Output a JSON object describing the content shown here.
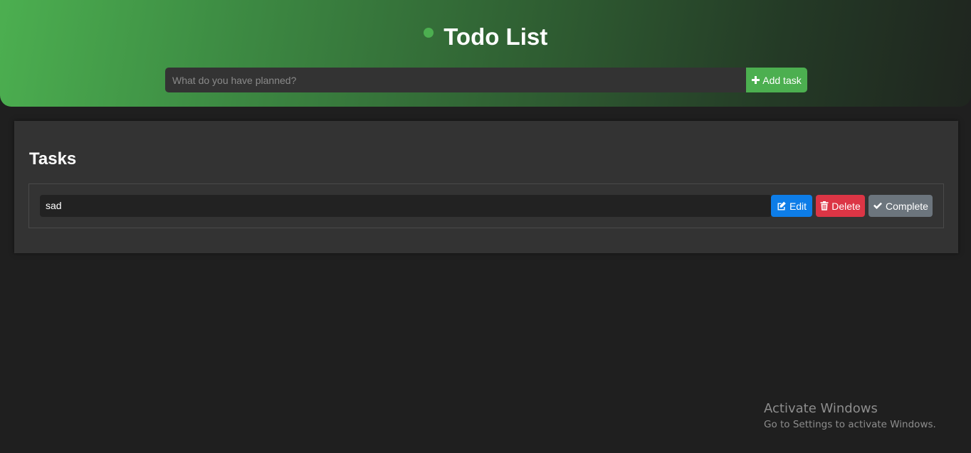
{
  "app": {
    "title": "Todo List"
  },
  "add_task": {
    "input_value": "",
    "placeholder": "What do you have planned?",
    "button_label": "Add task",
    "button_icon": "plus-icon"
  },
  "tasks_panel": {
    "heading": "Tasks",
    "items": [
      {
        "text": "sad",
        "actions": {
          "edit_label": "Edit",
          "edit_icon": "edit-icon",
          "delete_label": "Delete",
          "delete_icon": "trash-icon",
          "complete_label": "Complete",
          "complete_icon": "check-icon"
        }
      }
    ]
  },
  "watermark": {
    "title": "Activate Windows",
    "subtitle": "Go to Settings to activate Windows."
  },
  "colors": {
    "accent": "#4caf50",
    "edit": "#0d7de8",
    "delete": "#dc3545",
    "complete": "#6c757d",
    "background": "#1f1f1f",
    "panel": "#333333"
  }
}
